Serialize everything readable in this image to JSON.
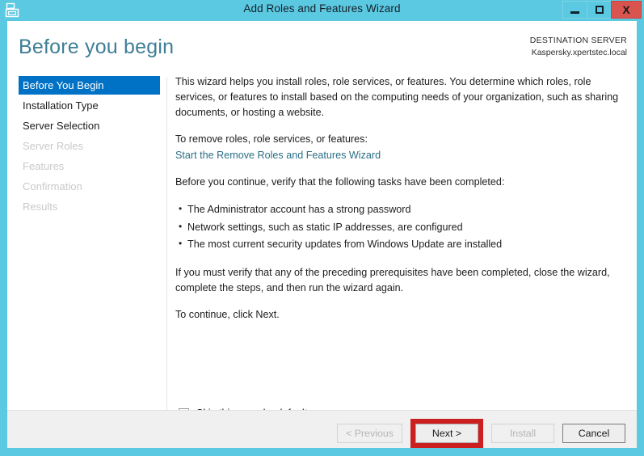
{
  "window": {
    "title": "Add Roles and Features Wizard",
    "icon": "server-manager-icon",
    "controls": {
      "minimize": "minimize-icon",
      "maximize": "maximize-icon",
      "close": "X"
    },
    "frame_color": "#5bc9e1"
  },
  "header": {
    "page_title": "Before you begin",
    "destination_label": "DESTINATION SERVER",
    "destination_value": "Kaspersky.xpertstec.local",
    "title_color": "#3f7e96"
  },
  "sidebar": {
    "items": [
      {
        "label": "Before You Begin",
        "state": "selected"
      },
      {
        "label": "Installation Type",
        "state": "enabled"
      },
      {
        "label": "Server Selection",
        "state": "enabled"
      },
      {
        "label": "Server Roles",
        "state": "disabled"
      },
      {
        "label": "Features",
        "state": "disabled"
      },
      {
        "label": "Confirmation",
        "state": "disabled"
      },
      {
        "label": "Results",
        "state": "disabled"
      }
    ],
    "selected_color": "#0072c6",
    "disabled_color": "#c9c9c9"
  },
  "content": {
    "intro": "This wizard helps you install roles, role services, or features. You determine which roles, role services, or features to install based on the computing needs of your organization, such as sharing documents, or hosting a website.",
    "remove_prompt": "To remove roles, role services, or features:",
    "remove_link": "Start the Remove Roles and Features Wizard",
    "link_color": "#2a6f85",
    "verify_prompt": "Before you continue, verify that the following tasks have been completed:",
    "tasks": [
      "The Administrator account has a strong password",
      "Network settings, such as static IP addresses, are configured",
      "The most current security updates from Windows Update are installed"
    ],
    "prereq_note": "If you must verify that any of the preceding prerequisites have been completed, close the wizard, complete the steps, and then run the wizard again.",
    "continue_note": "To continue, click Next."
  },
  "options": {
    "skip_page_label": "Skip this page by default",
    "skip_page_checked": false
  },
  "footer": {
    "buttons": [
      {
        "label": "< Previous",
        "state": "disabled",
        "highlighted": false
      },
      {
        "label": "Next >",
        "state": "enabled",
        "highlighted": true
      },
      {
        "label": "Install",
        "state": "disabled",
        "highlighted": false
      },
      {
        "label": "Cancel",
        "state": "enabled",
        "highlighted": false
      }
    ],
    "highlight_color": "#cc1f1f"
  }
}
